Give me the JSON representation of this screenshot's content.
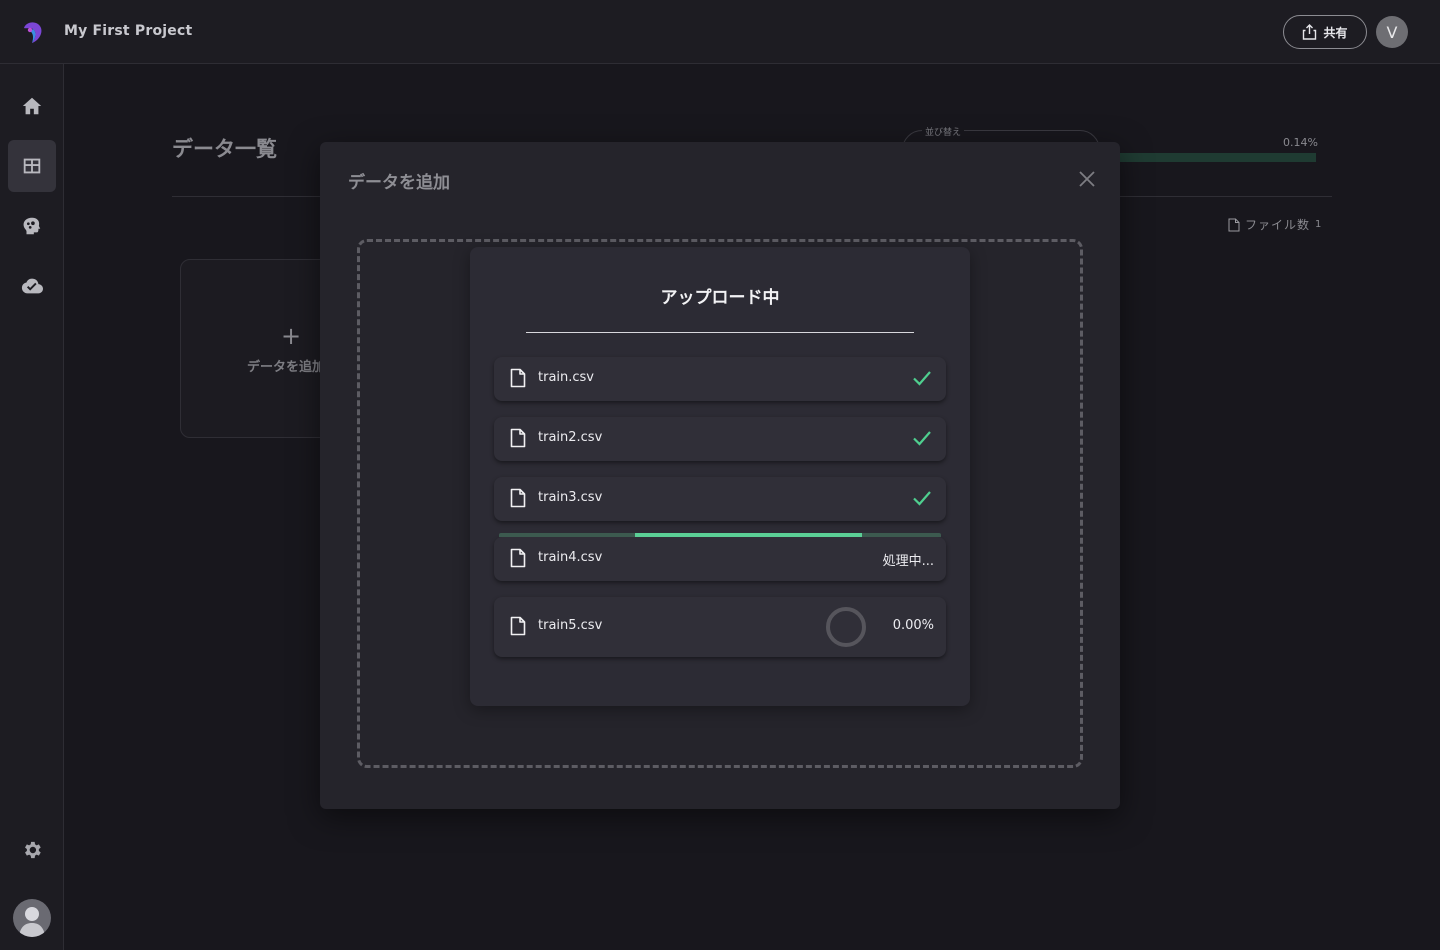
{
  "header": {
    "project_title": "My First Project",
    "share_label": "共有",
    "user_initial": "V"
  },
  "sidebar": {
    "items": [
      {
        "name": "home",
        "icon": "home-icon"
      },
      {
        "name": "data",
        "icon": "table-icon",
        "active": true
      },
      {
        "name": "models",
        "icon": "brain-icon"
      },
      {
        "name": "deploy",
        "icon": "cloud-check-icon"
      }
    ],
    "settings_icon": "gear-icon"
  },
  "page": {
    "title": "データ一覧",
    "sort_label": "並び替え",
    "storage_percent": "0.14%",
    "storage_fill_fraction": 0.0014,
    "file_count_label": "ファイル数",
    "file_count_value": "1",
    "add_card_plus": "+",
    "add_card_label": "データを追加"
  },
  "modal": {
    "title": "データを追加",
    "upload": {
      "title": "アップロード中",
      "files": [
        {
          "name": "train.csv",
          "status": "done"
        },
        {
          "name": "train2.csv",
          "status": "done"
        },
        {
          "name": "train3.csv",
          "status": "done"
        },
        {
          "name": "train4.csv",
          "status": "processing",
          "status_text": "処理中..."
        },
        {
          "name": "train5.csv",
          "status": "pending",
          "percent_text": "0.00%"
        }
      ]
    }
  },
  "colors": {
    "accent_green": "#5bcf96",
    "check_green": "#4fcf8f",
    "background": "#18171d"
  }
}
